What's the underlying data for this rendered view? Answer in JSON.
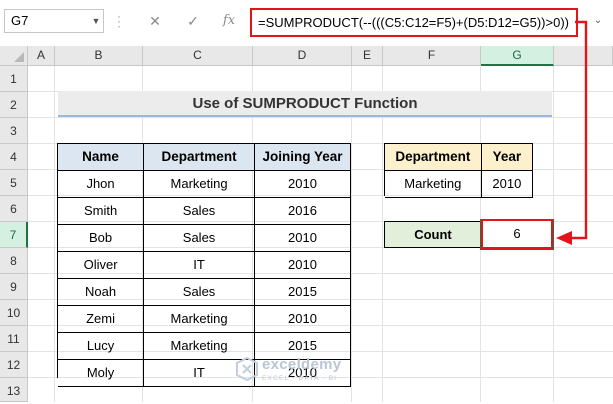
{
  "formula_bar": {
    "name_box": "G7",
    "cancel_glyph": "✕",
    "enter_glyph": "✓",
    "fx_label": "fx",
    "formula": "=SUMPRODUCT(--(((C5:C12=F5)+(D5:D12=G5))>0))"
  },
  "columns": [
    "A",
    "B",
    "C",
    "D",
    "E",
    "F",
    "G"
  ],
  "rows": [
    "1",
    "2",
    "3",
    "4",
    "5",
    "6",
    "7",
    "8",
    "9",
    "10",
    "11",
    "12",
    "13"
  ],
  "title": "Use of SUMPRODUCT Function",
  "table1": {
    "headers": [
      "Name",
      "Department",
      "Joining Year"
    ],
    "rows": [
      [
        "Jhon",
        "Marketing",
        "2010"
      ],
      [
        "Smith",
        "Sales",
        "2016"
      ],
      [
        "Bob",
        "Sales",
        "2010"
      ],
      [
        "Oliver",
        "IT",
        "2010"
      ],
      [
        "Noah",
        "Sales",
        "2015"
      ],
      [
        "Zemi",
        "Marketing",
        "2010"
      ],
      [
        "Lucy",
        "Marketing",
        "2015"
      ],
      [
        "Moly",
        "IT",
        "2010"
      ]
    ]
  },
  "criteria": {
    "headers": [
      "Department",
      "Year"
    ],
    "values": [
      "Marketing",
      "2010"
    ]
  },
  "count": {
    "label": "Count",
    "value": "6"
  },
  "watermark": {
    "brand": "exceldemy",
    "tagline": "EXCEL · DATA · BI"
  },
  "colors": {
    "highlight_red": "#e4141b",
    "selection_green": "#217346",
    "header_blue": "#dce6f1",
    "header_tan": "#fdf0cd",
    "count_green": "#e2efda"
  },
  "icons": [
    "name-box-dropdown-icon",
    "cancel-icon",
    "enter-icon",
    "function-icon",
    "arrow-icon"
  ]
}
